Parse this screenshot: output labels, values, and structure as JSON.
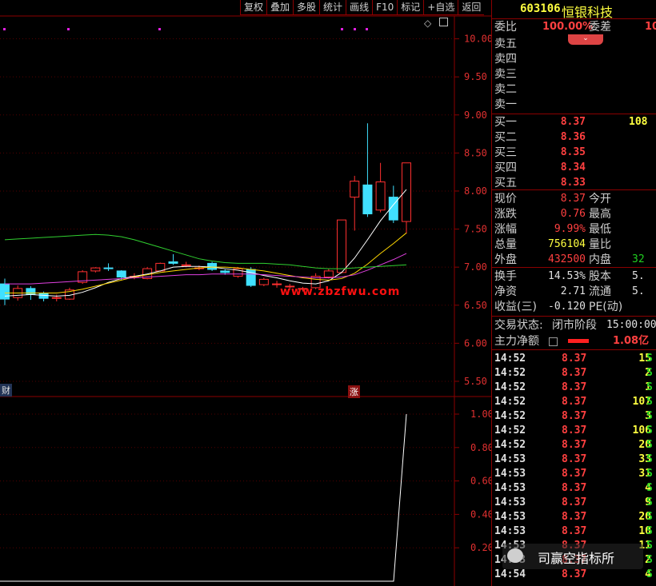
{
  "toolbar": {
    "items": [
      "复权",
      "叠加",
      "多股",
      "统计",
      "画线",
      "F10",
      "标记",
      "+自选",
      "返回"
    ]
  },
  "chart": {
    "watermark": "www.zbzfwu.com",
    "price_axis_ticks": [
      "10.00",
      "9.50",
      "9.00",
      "8.50",
      "8.00",
      "7.50",
      "7.00",
      "6.50",
      "6.00",
      "5.50"
    ],
    "indicator_axis_ticks": [
      "1.00",
      "0.80",
      "0.60",
      "0.40",
      "0.20"
    ],
    "marker_left": "财",
    "marker_up": "涨",
    "corner_icons": [
      "diamond-icon",
      "window-icon"
    ]
  },
  "chart_data": {
    "type": "candlestick",
    "ylim": [
      5.3,
      10.3
    ],
    "candles": [
      {
        "o": 6.78,
        "c": 6.58,
        "h": 6.85,
        "l": 6.5
      },
      {
        "o": 6.6,
        "c": 6.72,
        "h": 6.76,
        "l": 6.56
      },
      {
        "o": 6.72,
        "c": 6.64,
        "h": 6.75,
        "l": 6.57
      },
      {
        "o": 6.66,
        "c": 6.59,
        "h": 6.68,
        "l": 6.55
      },
      {
        "o": 6.59,
        "c": 6.6,
        "h": 6.64,
        "l": 6.55
      },
      {
        "o": 6.58,
        "c": 6.7,
        "h": 6.73,
        "l": 6.57
      },
      {
        "o": 6.8,
        "c": 6.94,
        "h": 6.96,
        "l": 6.78
      },
      {
        "o": 6.95,
        "c": 6.99,
        "h": 7.0,
        "l": 6.93
      },
      {
        "o": 6.99,
        "c": 6.98,
        "h": 7.05,
        "l": 6.95
      },
      {
        "o": 6.95,
        "c": 6.87,
        "h": 6.96,
        "l": 6.83
      },
      {
        "o": 6.88,
        "c": 6.88,
        "h": 6.92,
        "l": 6.84
      },
      {
        "o": 6.85,
        "c": 6.98,
        "h": 7.0,
        "l": 6.84
      },
      {
        "o": 6.95,
        "c": 7.05,
        "h": 7.06,
        "l": 6.94
      },
      {
        "o": 7.07,
        "c": 7.05,
        "h": 7.17,
        "l": 7.03
      },
      {
        "o": 7.03,
        "c": 7.03,
        "h": 7.07,
        "l": 7.0
      },
      {
        "o": 6.98,
        "c": 6.99,
        "h": 7.02,
        "l": 6.96
      },
      {
        "o": 7.05,
        "c": 6.97,
        "h": 7.07,
        "l": 6.95
      },
      {
        "o": 6.95,
        "c": 6.93,
        "h": 6.97,
        "l": 6.9
      },
      {
        "o": 6.88,
        "c": 6.98,
        "h": 7.0,
        "l": 6.86
      },
      {
        "o": 6.97,
        "c": 6.76,
        "h": 7.0,
        "l": 6.74
      },
      {
        "o": 6.77,
        "c": 6.84,
        "h": 6.86,
        "l": 6.75
      },
      {
        "o": 6.78,
        "c": 6.78,
        "h": 6.82,
        "l": 6.73
      },
      {
        "o": 6.75,
        "c": 6.75,
        "h": 6.78,
        "l": 6.7
      },
      {
        "o": 6.72,
        "c": 6.72,
        "h": 6.74,
        "l": 6.68
      },
      {
        "o": 6.73,
        "c": 6.88,
        "h": 6.92,
        "l": 6.71
      },
      {
        "o": 6.87,
        "c": 6.95,
        "h": 6.98,
        "l": 6.85
      },
      {
        "o": 6.93,
        "c": 7.62,
        "h": 7.62,
        "l": 6.92
      },
      {
        "o": 7.92,
        "c": 8.13,
        "h": 8.2,
        "l": 7.48
      },
      {
        "o": 8.08,
        "c": 7.7,
        "h": 8.89,
        "l": 7.66
      },
      {
        "o": 7.75,
        "c": 8.12,
        "h": 8.37,
        "l": 7.72
      },
      {
        "o": 7.92,
        "c": 7.62,
        "h": 8.07,
        "l": 7.58
      },
      {
        "o": 7.6,
        "c": 8.37,
        "h": 8.37,
        "l": 7.44
      }
    ],
    "ma": [
      {
        "name": "ma-white",
        "color": "#ffffff",
        "values": [
          6.62,
          6.63,
          6.64,
          6.63,
          6.62,
          6.63,
          6.67,
          6.73,
          6.8,
          6.85,
          6.88,
          6.91,
          6.95,
          7.0,
          7.01,
          7.01,
          7.0,
          6.98,
          6.96,
          6.93,
          6.89,
          6.86,
          6.82,
          6.79,
          6.78,
          6.82,
          6.93,
          7.12,
          7.36,
          7.61,
          7.82,
          8.02
        ]
      },
      {
        "name": "ma-yellow",
        "color": "#ffd700",
        "values": [
          6.66,
          6.66,
          6.66,
          6.66,
          6.66,
          6.68,
          6.71,
          6.75,
          6.79,
          6.83,
          6.87,
          6.9,
          6.93,
          6.95,
          6.97,
          6.99,
          7.0,
          7.0,
          6.99,
          6.97,
          6.95,
          6.92,
          6.89,
          6.86,
          6.84,
          6.83,
          6.85,
          6.92,
          7.04,
          7.18,
          7.31,
          7.45
        ]
      },
      {
        "name": "ma-magenta",
        "color": "#e040e0",
        "values": [
          6.78,
          6.78,
          6.78,
          6.79,
          6.8,
          6.81,
          6.82,
          6.83,
          6.84,
          6.85,
          6.86,
          6.87,
          6.88,
          6.89,
          6.9,
          6.9,
          6.91,
          6.91,
          6.91,
          6.91,
          6.9,
          6.89,
          6.88,
          6.87,
          6.86,
          6.86,
          6.87,
          6.9,
          6.96,
          7.03,
          7.1,
          7.18
        ]
      },
      {
        "name": "ma-green",
        "color": "#30d030",
        "values": [
          7.36,
          7.37,
          7.38,
          7.39,
          7.4,
          7.41,
          7.42,
          7.43,
          7.42,
          7.4,
          7.36,
          7.31,
          7.26,
          7.21,
          7.16,
          7.11,
          7.08,
          7.06,
          7.05,
          7.05,
          7.05,
          7.04,
          7.03,
          7.01,
          6.99,
          6.98,
          6.98,
          6.99,
          7.0,
          7.01,
          7.02,
          7.03
        ]
      }
    ],
    "indicator": {
      "ylim": [
        0,
        1.0
      ],
      "values": [
        0,
        0,
        0,
        0,
        0,
        0,
        0,
        0,
        0,
        0,
        0,
        0,
        0,
        0,
        0,
        0,
        0,
        0,
        0,
        0,
        0,
        0,
        0,
        0,
        0,
        0,
        0,
        0,
        0,
        0,
        0,
        1.0
      ]
    }
  },
  "sidebar": {
    "code": "603106",
    "name": "恒银科技",
    "weibi_label": "委比",
    "weibi_value": "100.00%",
    "weicha_label": "委差",
    "weicha_value": "10",
    "sell": [
      {
        "label": "卖五",
        "price": "",
        "vol": ""
      },
      {
        "label": "卖四",
        "price": "",
        "vol": ""
      },
      {
        "label": "卖三",
        "price": "",
        "vol": ""
      },
      {
        "label": "卖二",
        "price": "",
        "vol": ""
      },
      {
        "label": "卖一",
        "price": "",
        "vol": ""
      }
    ],
    "buy": [
      {
        "label": "买一",
        "price": "8.37",
        "vol": "108"
      },
      {
        "label": "买二",
        "price": "8.36",
        "vol": ""
      },
      {
        "label": "买三",
        "price": "8.35",
        "vol": ""
      },
      {
        "label": "买四",
        "price": "8.34",
        "vol": ""
      },
      {
        "label": "买五",
        "price": "8.33",
        "vol": ""
      }
    ],
    "stats": [
      {
        "l1": "现价",
        "v1": "8.37",
        "c1": "#ff4040",
        "l2": "今开",
        "v2": "",
        "c2": "#ff4040"
      },
      {
        "l1": "涨跌",
        "v1": "0.76",
        "c1": "#ff4040",
        "l2": "最高",
        "v2": "",
        "c2": "#ff4040"
      },
      {
        "l1": "涨幅",
        "v1": "9.99%",
        "c1": "#ff4040",
        "l2": "最低",
        "v2": "",
        "c2": "#ff4040"
      },
      {
        "l1": "总量",
        "v1": "756104",
        "c1": "#ffff40",
        "l2": "量比",
        "v2": "",
        "c2": "#ffff40"
      },
      {
        "l1": "外盘",
        "v1": "432500",
        "c1": "#ff4040",
        "l2": "内盘",
        "v2": "32",
        "c2": "#20d020"
      }
    ],
    "stats2": [
      {
        "l1": "换手",
        "v1": "14.53%",
        "c1": "#e0e0e0",
        "l2": "股本",
        "v2": "5.",
        "c2": "#e0e0e0"
      },
      {
        "l1": "净资",
        "v1": "2.71",
        "c1": "#e0e0e0",
        "l2": "流通",
        "v2": "5.",
        "c2": "#e0e0e0"
      },
      {
        "l1": "收益(三)",
        "v1": "-0.120",
        "c1": "#e0e0e0",
        "l2": "PE(动)",
        "v2": "",
        "c2": "#e0e0e0"
      }
    ],
    "status_label": "交易状态:",
    "status_value": "闭市阶段",
    "status_time": "15:00:00",
    "main_force_label": "主力净额",
    "main_force_value": "1.08亿",
    "ticks": [
      {
        "time": "14:52",
        "price": "8.37",
        "vol": "15",
        "dir": "S"
      },
      {
        "time": "14:52",
        "price": "8.37",
        "vol": "2",
        "dir": "S"
      },
      {
        "time": "14:52",
        "price": "8.37",
        "vol": "1",
        "dir": "S"
      },
      {
        "time": "14:52",
        "price": "8.37",
        "vol": "107",
        "dir": "S"
      },
      {
        "time": "14:52",
        "price": "8.37",
        "vol": "3",
        "dir": "S"
      },
      {
        "time": "14:52",
        "price": "8.37",
        "vol": "106",
        "dir": "S"
      },
      {
        "time": "14:52",
        "price": "8.37",
        "vol": "20",
        "dir": "S"
      },
      {
        "time": "14:53",
        "price": "8.37",
        "vol": "33",
        "dir": "S"
      },
      {
        "time": "14:53",
        "price": "8.37",
        "vol": "31",
        "dir": "S"
      },
      {
        "time": "14:53",
        "price": "8.37",
        "vol": "4",
        "dir": "S"
      },
      {
        "time": "14:53",
        "price": "8.37",
        "vol": "9",
        "dir": "S"
      },
      {
        "time": "14:53",
        "price": "8.37",
        "vol": "20",
        "dir": "S"
      },
      {
        "time": "14:53",
        "price": "8.37",
        "vol": "10",
        "dir": "S"
      },
      {
        "time": "14:53",
        "price": "8.37",
        "vol": "11",
        "dir": "S"
      },
      {
        "time": "14:53",
        "price": "8.37",
        "vol": "2",
        "dir": "S"
      },
      {
        "time": "14:54",
        "price": "8.37",
        "vol": "4",
        "dir": "S"
      }
    ],
    "overlay_text": "司赢空指标所"
  }
}
